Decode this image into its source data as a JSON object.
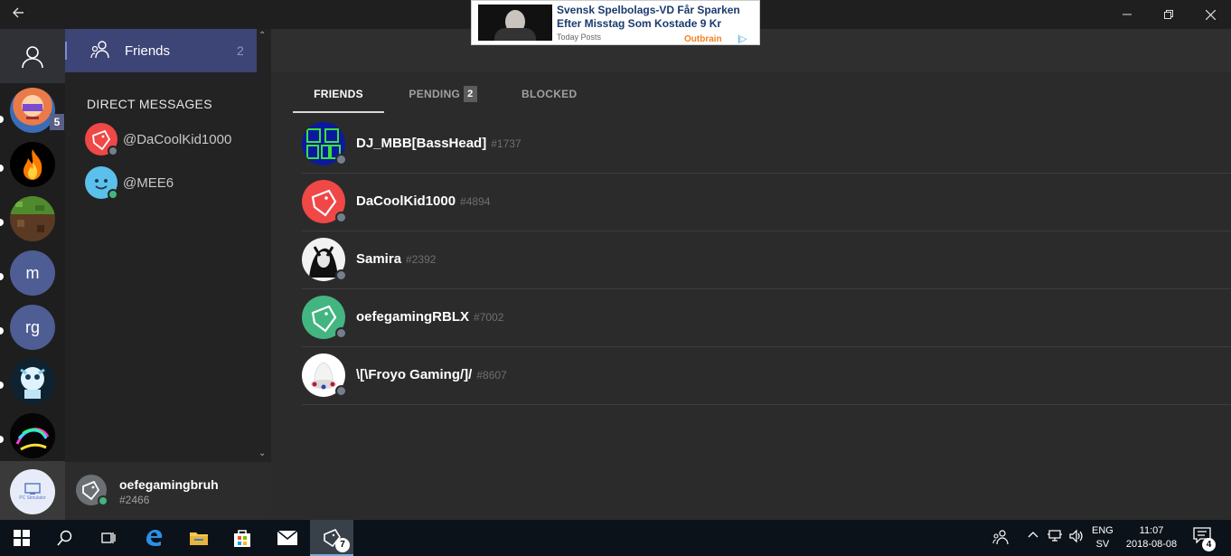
{
  "window": {
    "back_icon": "back-arrow-icon",
    "controls": [
      "minimize-icon",
      "maximize-icon",
      "close-icon"
    ]
  },
  "ad": {
    "title": "Svensk Spelbolags-VD Får Sparken Efter Misstag Som Kostade 9 Kr",
    "source": "Today Posts",
    "brand": "Outbrain",
    "info": "|▷"
  },
  "rail": {
    "home_icon": "user-icon",
    "servers": [
      {
        "kind": "image",
        "name": "cartoon-avatar",
        "badge": "5"
      },
      {
        "kind": "image",
        "name": "fire"
      },
      {
        "kind": "image",
        "name": "minecraft-block"
      },
      {
        "kind": "initials",
        "text": "m",
        "color": "#4e5d94"
      },
      {
        "kind": "initials",
        "text": "rg",
        "color": "#4e5d94"
      },
      {
        "kind": "image",
        "name": "robot-dog"
      },
      {
        "kind": "image",
        "name": "neon-swirl"
      },
      {
        "kind": "image",
        "name": "pc-simulator",
        "label": "PC Simulator"
      }
    ]
  },
  "channels": {
    "friends_label": "Friends",
    "friends_count": "2",
    "dm_header": "DIRECT MESSAGES",
    "dms": [
      {
        "name": "@DaCoolKid1000",
        "avatar_color": "#f04747",
        "status_color": "#747f8d"
      },
      {
        "name": "@MEE6",
        "avatar_color": "#5bc0eb",
        "status_color": "#43b581"
      }
    ],
    "scroll_up": "⌃",
    "scroll_down": "⌄"
  },
  "user": {
    "name": "oefegamingbruh",
    "tag": "#2466",
    "status_color": "#43b581"
  },
  "tabs": [
    {
      "label": "FRIENDS",
      "active": true
    },
    {
      "label": "PENDING",
      "badge": "2"
    },
    {
      "label": "BLOCKED"
    }
  ],
  "friends": [
    {
      "name": "DJ_MBB[BassHead]",
      "tag": "#1737",
      "avatar": "dj-logo"
    },
    {
      "name": "DaCoolKid1000",
      "tag": "#4894",
      "avatar": "discord-red"
    },
    {
      "name": "Samira",
      "tag": "#2392",
      "avatar": "anime-bw"
    },
    {
      "name": "oefegamingRBLX",
      "tag": "#7002",
      "avatar": "discord-green"
    },
    {
      "name": "\\[\\Froyo Gaming/]/",
      "tag": "#8607",
      "avatar": "froyo"
    }
  ],
  "taskbar": {
    "items": [
      "windows-start-icon",
      "search-icon",
      "task-view-icon",
      "edge-icon",
      "file-explorer-icon",
      "store-icon",
      "mail-icon",
      "discord-icon"
    ],
    "discord_badge": "7",
    "lang": "ENG",
    "lang_sub": "SV",
    "time": "11:07",
    "date": "2018-08-08",
    "notification_badge": "4"
  },
  "colors": {
    "accent": "#7289da",
    "selected_bg": "#3d4476",
    "offline": "#747f8d",
    "online": "#43b581"
  }
}
